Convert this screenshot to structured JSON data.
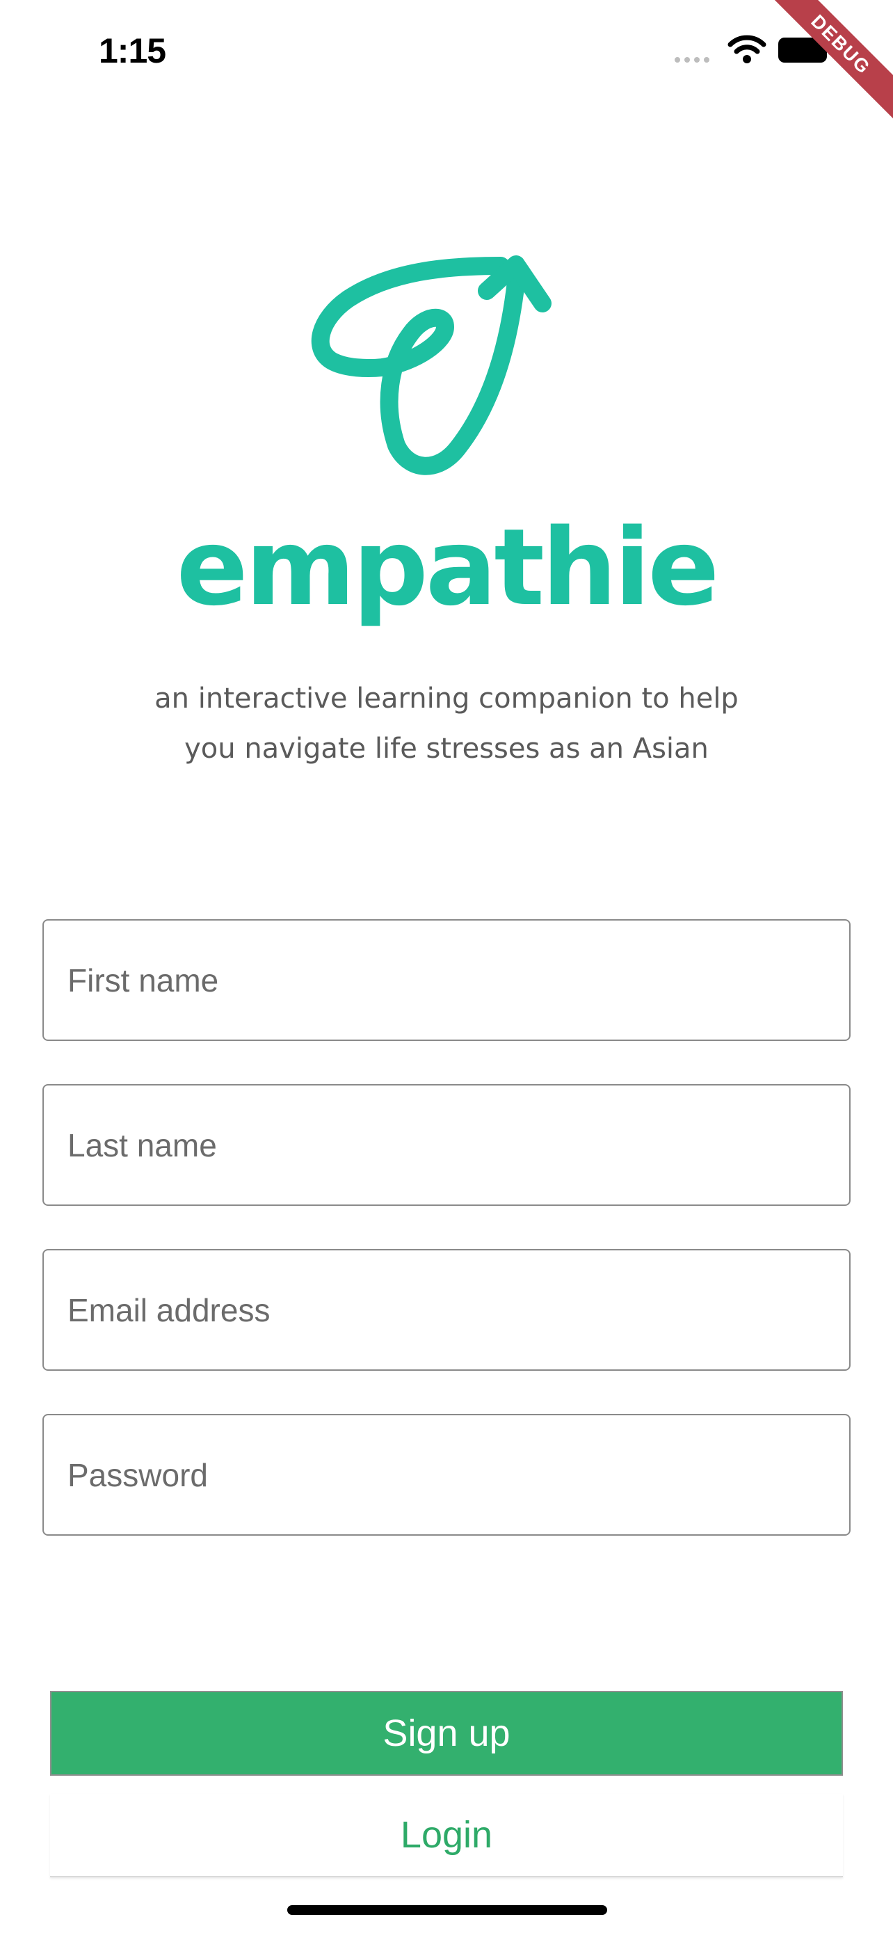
{
  "status_bar": {
    "time": "1:15"
  },
  "debug_banner": "DEBUG",
  "brand": {
    "name": "empathie",
    "tagline_line1": "an interactive learning companion to help",
    "tagline_line2": "you navigate life stresses as an Asian",
    "color": "#1ec0a1"
  },
  "form": {
    "first_name_placeholder": "First name",
    "last_name_placeholder": "Last name",
    "email_placeholder": "Email address",
    "password_placeholder": "Password"
  },
  "actions": {
    "signup_label": "Sign up",
    "login_label": "Login",
    "primary_color": "#33b06e"
  }
}
